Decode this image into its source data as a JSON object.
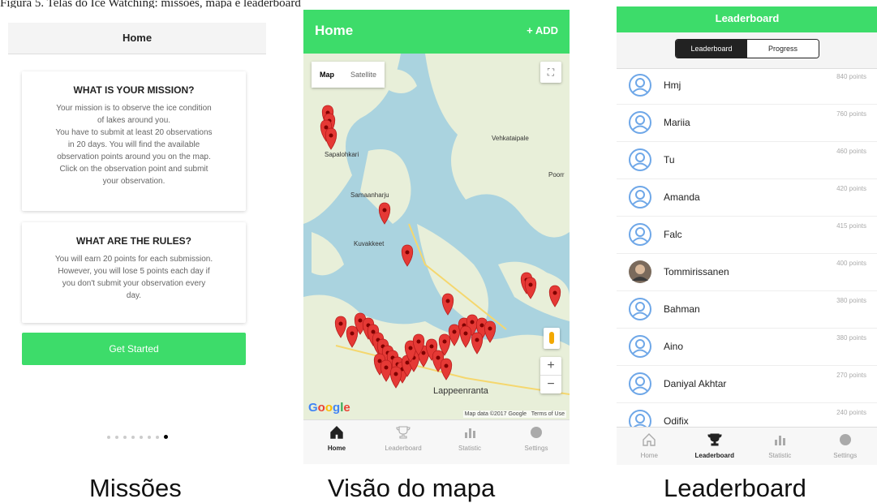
{
  "top_caption": "Figura 5. Telas do Ice Watching: missões, mapa e leaderboard",
  "captions": {
    "s1": "Missões",
    "s2": "Visão do mapa",
    "s3": "Leaderboard"
  },
  "screen1": {
    "title": "Home",
    "cards": [
      {
        "heading": "WHAT IS YOUR MISSION?",
        "body": "Your mission is to observe the ice condition\nof lakes around you.\nYou have to submit at least 20 observations\nin 20 days. You will find the available\nobservation points around you on the map.\nClick on the observation point and submit\nyour observation."
      },
      {
        "heading": "WHAT ARE THE RULES?",
        "body": "You will earn 20 points for each submission.\nHowever, you will lose 5 points each day if\nyou don't submit your observation every\nday."
      }
    ],
    "button": "Get Started",
    "page_dots": {
      "count": 8,
      "active": 8
    }
  },
  "screen2": {
    "title": "Home",
    "add_label": "+ ADD",
    "map_toggle": {
      "map": "Map",
      "satellite": "Satellite"
    },
    "map_labels": [
      "Sapalohkari",
      "Vehkataipale",
      "Samaanharju",
      "Kuvakkeet",
      "Lappeenranta",
      "Poorr"
    ],
    "map_attribution": {
      "google": "Google",
      "credit": "Map data ©2017 Google",
      "terms": "Terms of Use"
    },
    "zoom": {
      "in": "+",
      "out": "−"
    },
    "tabs": [
      {
        "label": "Home",
        "icon": "home-icon",
        "active": true
      },
      {
        "label": "Leaderboard",
        "icon": "trophy-icon",
        "active": false
      },
      {
        "label": "Statistic",
        "icon": "bar-chart-icon",
        "active": false
      },
      {
        "label": "Settings",
        "icon": "settings-circle-icon",
        "active": false
      }
    ]
  },
  "screen3": {
    "title": "Leaderboard",
    "segments": {
      "on": "Leaderboard",
      "off": "Progress"
    },
    "entries": [
      {
        "name": "Hmj",
        "points": "840 points",
        "photo": false
      },
      {
        "name": "Mariia",
        "points": "760 points",
        "photo": false
      },
      {
        "name": "Tu",
        "points": "460 points",
        "photo": false
      },
      {
        "name": "Amanda",
        "points": "420 points",
        "photo": false
      },
      {
        "name": "Falc",
        "points": "415 points",
        "photo": false
      },
      {
        "name": "Tommirissanen",
        "points": "400 points",
        "photo": true
      },
      {
        "name": "Bahman",
        "points": "380 points",
        "photo": false
      },
      {
        "name": "Aino",
        "points": "380 points",
        "photo": false
      },
      {
        "name": "Daniyal Akhtar",
        "points": "270 points",
        "photo": false
      },
      {
        "name": "Odifix",
        "points": "240 points",
        "photo": false
      }
    ],
    "tabs": [
      {
        "label": "Home",
        "icon": "home-icon",
        "active": false
      },
      {
        "label": "Leaderboard",
        "icon": "trophy-icon",
        "active": true
      },
      {
        "label": "Statistic",
        "icon": "bar-chart-icon",
        "active": false
      },
      {
        "label": "Settings",
        "icon": "settings-circle-icon",
        "active": false
      }
    ]
  },
  "colors": {
    "accent": "#3ddc6a",
    "pin": "#e53935",
    "water": "#aad3df",
    "land": "#e8efd9"
  }
}
